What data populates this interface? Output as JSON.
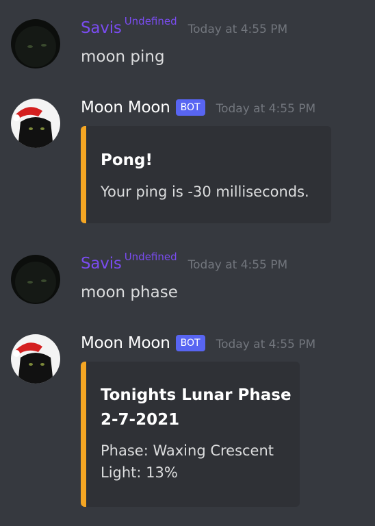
{
  "messages": [
    {
      "author": "Savis",
      "role_tag": "Undefined",
      "timestamp": "Today at 4:55 PM",
      "text": "moon ping"
    },
    {
      "author": "Moon Moon",
      "badge": "BOT",
      "timestamp": "Today at 4:55 PM",
      "embed": {
        "title": "Pong!",
        "description": "Your ping is -30 milliseconds.",
        "accent_color": "#f5a623"
      }
    },
    {
      "author": "Savis",
      "role_tag": "Undefined",
      "timestamp": "Today at 4:55 PM",
      "text": "moon phase"
    },
    {
      "author": "Moon Moon",
      "badge": "BOT",
      "timestamp": "Today at 4:55 PM",
      "embed": {
        "title_line1": "Tonights Lunar Phase",
        "title_line2": "2-7-2021",
        "desc_line1": "Phase: Waxing Crescent",
        "desc_line2": "Light: 13%",
        "accent_color": "#f5a623"
      }
    }
  ],
  "colors": {
    "background": "#36393f",
    "embed_background": "#2f3136",
    "user_name": "#7a4cf0",
    "bot_badge": "#5865f2",
    "timestamp": "#72767d"
  },
  "icons": {
    "user_avatar": "black-cat-avatar-icon",
    "bot_avatar": "santa-hat-cat-avatar-icon"
  }
}
